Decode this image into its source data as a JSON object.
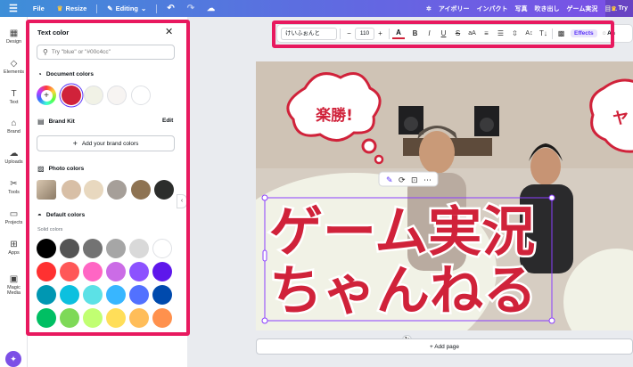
{
  "topbar": {
    "file": "File",
    "resize": "Resize",
    "editing": "Editing",
    "menu_items": [
      "アイボリー",
      "インパクト",
      "写真",
      "吹き出し",
      "ゲーム実況",
      "目…"
    ],
    "try_label": "Try"
  },
  "rail": {
    "items": [
      {
        "label": "Design",
        "icon": "grid-icon"
      },
      {
        "label": "Elements",
        "icon": "shapes-icon"
      },
      {
        "label": "Text",
        "icon": "text-icon"
      },
      {
        "label": "Brand",
        "icon": "brand-icon"
      },
      {
        "label": "Uploads",
        "icon": "cloud-upload-icon"
      },
      {
        "label": "Tools",
        "icon": "tools-icon"
      },
      {
        "label": "Projects",
        "icon": "folder-icon"
      },
      {
        "label": "Apps",
        "icon": "apps-icon"
      },
      {
        "label": "Magic Media",
        "icon": "magic-media-icon"
      }
    ]
  },
  "panel": {
    "title": "Text color",
    "search_placeholder": "Try \"blue\" or \"#00c4cc\"",
    "document_colors_title": "Document colors",
    "document_colors": [
      "#d0223a",
      "#f1f2e6",
      "#f7f4f2",
      "#ffffff"
    ],
    "brand_kit_title": "Brand Kit",
    "brand_edit": "Edit",
    "add_brand_colors": "Add your brand colors",
    "photo_colors_title": "Photo colors",
    "photo_colors": [
      "#d8bfa6",
      "#e8d8bf",
      "#a69f99",
      "#8e7352",
      "#2b2d2b"
    ],
    "default_colors_title": "Default colors",
    "solid_colors_label": "Solid colors",
    "solid_colors": [
      [
        "#000000",
        "#545454",
        "#737373",
        "#a6a6a6",
        "#d9d9d9",
        "#ffffff"
      ],
      [
        "#ff3131",
        "#ff5757",
        "#ff66c4",
        "#cb6ce6",
        "#8c52ff",
        "#5e17eb"
      ],
      [
        "#0097b2",
        "#0cc0df",
        "#5ce1e6",
        "#38b6ff",
        "#5271ff",
        "#004aad"
      ],
      [
        "#00bf63",
        "#7ed957",
        "#c1ff72",
        "#ffde59",
        "#ffbd59",
        "#ff914d"
      ]
    ]
  },
  "toolbar": {
    "font": "けいふぉんと",
    "size": "110",
    "effects": "Effects",
    "animate": "An"
  },
  "canvas": {
    "bubble_text": "楽勝!",
    "bubble_text_right": "ヤ",
    "headline_line1": "ゲーム実況",
    "headline_line2": "ちゃんねる"
  },
  "footer": {
    "add_page": "+ Add page"
  },
  "colors": {
    "accent_red": "#d0223a",
    "highlight_pink": "#e8195f",
    "brand_purple": "#5a32fa"
  }
}
